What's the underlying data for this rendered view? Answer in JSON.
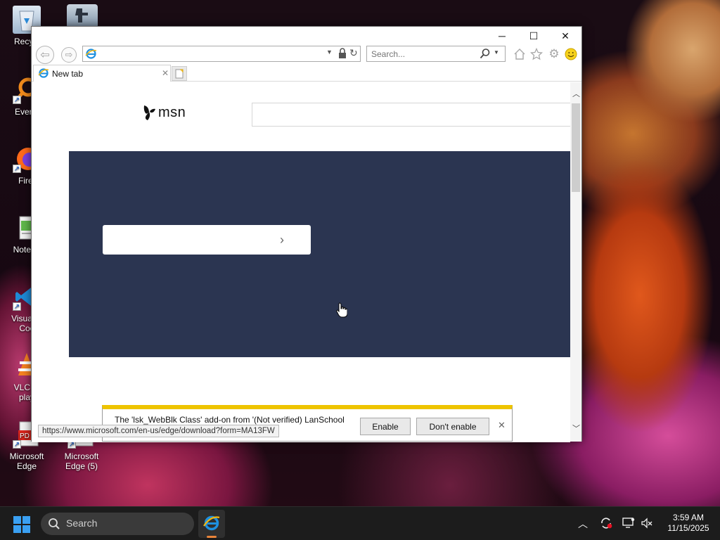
{
  "desktop": {
    "icons": [
      {
        "label": "Recycl",
        "icon": "recycle-bin-icon"
      },
      {
        "label": "Everyt",
        "icon": "everything-search-icon"
      },
      {
        "label": "Firef",
        "icon": "firefox-icon"
      },
      {
        "label": "Notepa",
        "icon": "notepad-icon"
      },
      {
        "label": "Visual S",
        "label2": "Coc",
        "icon": "vscode-icon"
      },
      {
        "label": "VLC m",
        "label2": "play",
        "icon": "vlc-icon"
      },
      {
        "label": "Microsoft",
        "label2": "Edge",
        "icon": "pdf-icon"
      },
      {
        "label": "Microsoft",
        "label2": "Edge (5)",
        "icon": "pdf-icon"
      }
    ]
  },
  "browser": {
    "window_controls": {
      "minimize": "─",
      "maximize": "☐",
      "close": "✕"
    },
    "address": {
      "value": ""
    },
    "search": {
      "placeholder": "Search..."
    },
    "tabs": [
      {
        "label": "New tab"
      }
    ]
  },
  "page": {
    "logo_text": "msn"
  },
  "notification": {
    "message": "The 'lsk_WebBlk Class' add-on from '(Not verified) LanSchool",
    "enable_label": "Enable",
    "dont_enable_label": "Don't enable",
    "close": "✕"
  },
  "status_bar": {
    "url": "https://www.microsoft.com/en-us/edge/download?form=MA13FW"
  },
  "taskbar": {
    "search_label": "Search",
    "time": "3:59 AM",
    "date": "11/15/2025"
  },
  "colors": {
    "hero_bg": "#2b3551",
    "notification_accent": "#eec400",
    "taskbar_bg": "#1c1c1c"
  }
}
